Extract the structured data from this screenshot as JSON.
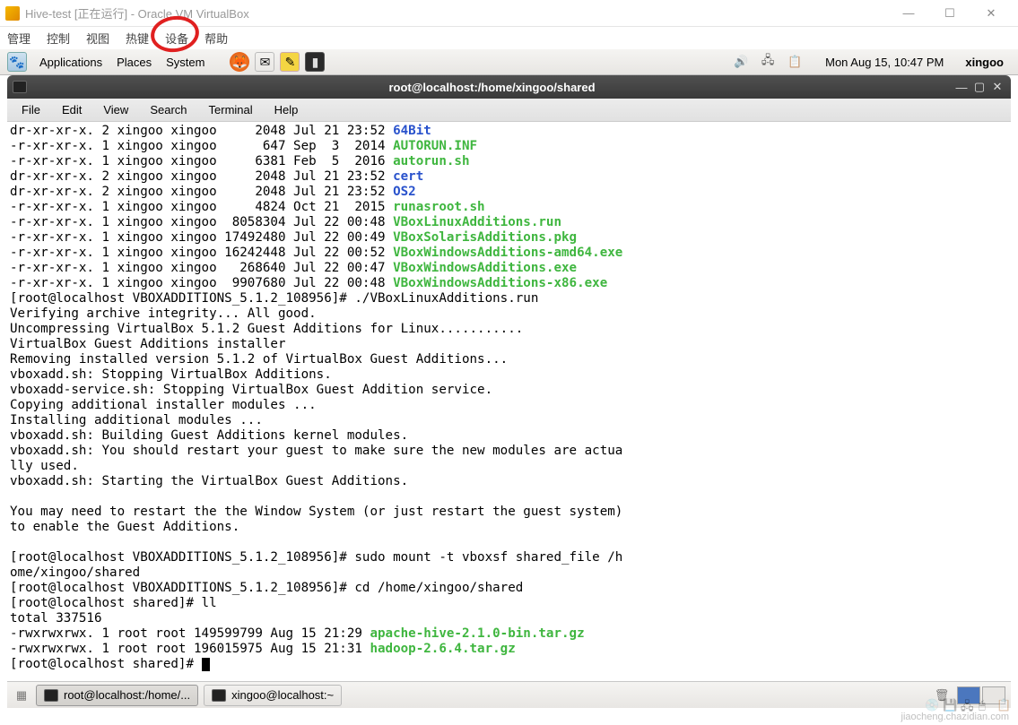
{
  "vbox": {
    "title": "Hive-test [正在运行] - Oracle VM VirtualBox",
    "menu": [
      "管理",
      "控制",
      "视图",
      "热键",
      "设备",
      "帮助"
    ]
  },
  "gnome": {
    "menus": [
      "Applications",
      "Places",
      "System"
    ],
    "clock": "Mon Aug 15, 10:47 PM",
    "user": "xingoo"
  },
  "terminal": {
    "title": "root@localhost:/home/xingoo/shared",
    "menus": [
      "File",
      "Edit",
      "View",
      "Search",
      "Terminal",
      "Help"
    ],
    "listing1": [
      {
        "perm": "dr-xr-xr-x.",
        "links": "2",
        "own": "xingoo",
        "grp": "xingoo",
        "size": "    2048",
        "date": "Jul 21 23:52",
        "name": "64Bit",
        "cls": "c-blue"
      },
      {
        "perm": "-r-xr-xr-x.",
        "links": "1",
        "own": "xingoo",
        "grp": "xingoo",
        "size": "     647",
        "date": "Sep  3  2014",
        "name": "AUTORUN.INF",
        "cls": "c-green"
      },
      {
        "perm": "-r-xr-xr-x.",
        "links": "1",
        "own": "xingoo",
        "grp": "xingoo",
        "size": "    6381",
        "date": "Feb  5  2016",
        "name": "autorun.sh",
        "cls": "c-green"
      },
      {
        "perm": "dr-xr-xr-x.",
        "links": "2",
        "own": "xingoo",
        "grp": "xingoo",
        "size": "    2048",
        "date": "Jul 21 23:52",
        "name": "cert",
        "cls": "c-blue"
      },
      {
        "perm": "dr-xr-xr-x.",
        "links": "2",
        "own": "xingoo",
        "grp": "xingoo",
        "size": "    2048",
        "date": "Jul 21 23:52",
        "name": "OS2",
        "cls": "c-blue"
      },
      {
        "perm": "-r-xr-xr-x.",
        "links": "1",
        "own": "xingoo",
        "grp": "xingoo",
        "size": "    4824",
        "date": "Oct 21  2015",
        "name": "runasroot.sh",
        "cls": "c-green"
      },
      {
        "perm": "-r-xr-xr-x.",
        "links": "1",
        "own": "xingoo",
        "grp": "xingoo",
        "size": " 8058304",
        "date": "Jul 22 00:48",
        "name": "VBoxLinuxAdditions.run",
        "cls": "c-green"
      },
      {
        "perm": "-r-xr-xr-x.",
        "links": "1",
        "own": "xingoo",
        "grp": "xingoo",
        "size": "17492480",
        "date": "Jul 22 00:49",
        "name": "VBoxSolarisAdditions.pkg",
        "cls": "c-green"
      },
      {
        "perm": "-r-xr-xr-x.",
        "links": "1",
        "own": "xingoo",
        "grp": "xingoo",
        "size": "16242448",
        "date": "Jul 22 00:52",
        "name": "VBoxWindowsAdditions-amd64.exe",
        "cls": "c-green"
      },
      {
        "perm": "-r-xr-xr-x.",
        "links": "1",
        "own": "xingoo",
        "grp": "xingoo",
        "size": "  268640",
        "date": "Jul 22 00:47",
        "name": "VBoxWindowsAdditions.exe",
        "cls": "c-green"
      },
      {
        "perm": "-r-xr-xr-x.",
        "links": "1",
        "own": "xingoo",
        "grp": "xingoo",
        "size": " 9907680",
        "date": "Jul 22 00:48",
        "name": "VBoxWindowsAdditions-x86.exe",
        "cls": "c-green"
      }
    ],
    "body_lines": [
      "[root@localhost VBOXADDITIONS_5.1.2_108956]# ./VBoxLinuxAdditions.run",
      "Verifying archive integrity... All good.",
      "Uncompressing VirtualBox 5.1.2 Guest Additions for Linux...........",
      "VirtualBox Guest Additions installer",
      "Removing installed version 5.1.2 of VirtualBox Guest Additions...",
      "vboxadd.sh: Stopping VirtualBox Additions.",
      "vboxadd-service.sh: Stopping VirtualBox Guest Addition service.",
      "Copying additional installer modules ...",
      "Installing additional modules ...",
      "vboxadd.sh: Building Guest Additions kernel modules.",
      "vboxadd.sh: You should restart your guest to make sure the new modules are actua",
      "lly used.",
      "vboxadd.sh: Starting the VirtualBox Guest Additions.",
      "",
      "You may need to restart the the Window System (or just restart the guest system)",
      "to enable the Guest Additions.",
      "",
      "[root@localhost VBOXADDITIONS_5.1.2_108956]# sudo mount -t vboxsf shared_file /h",
      "ome/xingoo/shared",
      "[root@localhost VBOXADDITIONS_5.1.2_108956]# cd /home/xingoo/shared",
      "[root@localhost shared]# ll",
      "total 337516"
    ],
    "listing2": [
      {
        "perm": "-rwxrwxrwx.",
        "links": "1",
        "own": "root",
        "grp": "root",
        "size": "149599799",
        "date": "Aug 15 21:29",
        "name": "apache-hive-2.1.0-bin.tar.gz",
        "cls": "c-green"
      },
      {
        "perm": "-rwxrwxrwx.",
        "links": "1",
        "own": "root",
        "grp": "root",
        "size": "196015975",
        "date": "Aug 15 21:31",
        "name": "hadoop-2.6.4.tar.gz",
        "cls": "c-green"
      }
    ],
    "prompt_final": "[root@localhost shared]# "
  },
  "taskbar": {
    "tasks": [
      {
        "label": "root@localhost:/home/...",
        "active": true
      },
      {
        "label": "xingoo@localhost:~",
        "active": false
      }
    ]
  },
  "watermark": "jiaocheng.chazidian.com"
}
